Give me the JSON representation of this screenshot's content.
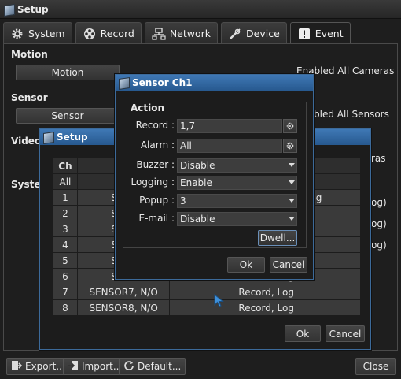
{
  "window": {
    "title": "Setup"
  },
  "tabs": [
    {
      "label": "System",
      "icon": "gear-icon"
    },
    {
      "label": "Record",
      "icon": "film-reel-icon"
    },
    {
      "label": "Network",
      "icon": "network-icon"
    },
    {
      "label": "Device",
      "icon": "wrench-icon"
    },
    {
      "label": "Event",
      "icon": "alert-icon"
    }
  ],
  "event": {
    "motion": {
      "heading": "Motion",
      "button": "Motion",
      "status": "Enabled All Cameras"
    },
    "sensor": {
      "heading": "Sensor",
      "button": "Sensor",
      "status": "bled All Sensors"
    },
    "video": {
      "heading": "Video",
      "status": "ras"
    },
    "system": {
      "heading": "Systen",
      "row_tail": "og)"
    }
  },
  "bottom": {
    "export": "Export...",
    "import": "Import...",
    "default": "Default...",
    "close": "Close"
  },
  "setup_dialog": {
    "title": "Setup",
    "columns": [
      "Ch",
      "Se"
    ],
    "all_label": "All",
    "rows": [
      {
        "ch": "1",
        "sensor": "SENS",
        "action": "og"
      },
      {
        "ch": "2",
        "sensor": "SENS",
        "action": ""
      },
      {
        "ch": "3",
        "sensor": "SENS",
        "action": ""
      },
      {
        "ch": "4",
        "sensor": "SENS",
        "action": ""
      },
      {
        "ch": "5",
        "sensor": "SENS",
        "action": ""
      },
      {
        "ch": "6",
        "sensor": "SENS",
        "action": "Record, Log"
      },
      {
        "ch": "7",
        "sensor": "SENSOR7, N/O",
        "action": "Record, Log"
      },
      {
        "ch": "8",
        "sensor": "SENSOR8, N/O",
        "action": "Record, Log"
      }
    ],
    "ok": "Ok",
    "cancel": "Cancel"
  },
  "sensor_dialog": {
    "title": "Sensor Ch1",
    "group": "Action",
    "record": {
      "label": "Record :",
      "value": "1,7"
    },
    "alarm": {
      "label": "Alarm :",
      "value": "All"
    },
    "buzzer": {
      "label": "Buzzer :",
      "value": "Disable"
    },
    "logging": {
      "label": "Logging :",
      "value": "Enable"
    },
    "popup": {
      "label": "Popup :",
      "value": "3"
    },
    "email": {
      "label": "E-mail :",
      "value": "Disable"
    },
    "dwell": "Dwell...",
    "ok": "Ok",
    "cancel": "Cancel"
  }
}
